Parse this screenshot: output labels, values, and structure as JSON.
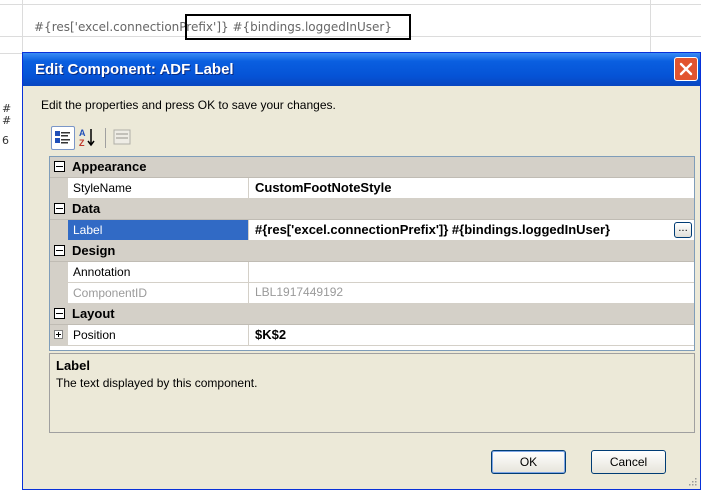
{
  "sheet": {
    "cell_text": "#{res['excel.connectionPrefix']} #{bindings.loggedInUser}",
    "row_fragments": [
      "#",
      "#",
      "6"
    ]
  },
  "dialog": {
    "title": "Edit Component: ADF Label",
    "instructions": "Edit the properties and press OK to save your changes.",
    "toolbar": {
      "icons": [
        "categorized-icon",
        "alphabetical-sort-icon",
        "property-pages-icon"
      ]
    },
    "grid": {
      "categories": [
        {
          "name": "Appearance",
          "props": [
            {
              "name": "StyleName",
              "value": "CustomFootNoteStyle"
            }
          ]
        },
        {
          "name": "Data",
          "props": [
            {
              "name": "Label",
              "value": "#{res['excel.connectionPrefix']} #{bindings.loggedInUser}"
            }
          ]
        },
        {
          "name": "Design",
          "props": [
            {
              "name": "Annotation",
              "value": ""
            },
            {
              "name": "ComponentID",
              "value": "LBL1917449192"
            }
          ]
        },
        {
          "name": "Layout",
          "props": [
            {
              "name": "Position",
              "value": "$K$2"
            }
          ]
        }
      ],
      "ellipsis_label": "..."
    },
    "description": {
      "title": "Label",
      "text": "The text displayed by this component."
    },
    "buttons": {
      "ok": "OK",
      "cancel": "Cancel"
    }
  },
  "colors": {
    "titlebar": "#0553d6",
    "selection": "#316ac5",
    "dialog_bg": "#ece9d8",
    "close": "#e2552f"
  }
}
